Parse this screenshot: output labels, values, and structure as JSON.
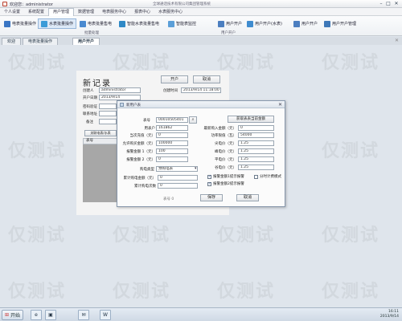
{
  "titlebar": {
    "title": "欢迎您：administrator",
    "center": "全球通话技术有限公司集团管理系统"
  },
  "menu": [
    "个人设置",
    "系统配置",
    "用户管理",
    "数据管理",
    "电表服务中心",
    "报表中心",
    "水表服务中心"
  ],
  "ribbon": {
    "buttons": [
      {
        "label": "电表批量操作",
        "color": "#3a76c4"
      },
      {
        "label": "水表批量操作",
        "color": "#3a9bd8"
      },
      {
        "label": "电表批量售电",
        "color": "#4a8ad0"
      },
      {
        "label": "智能水表批量售电",
        "color": "#2f89c6"
      },
      {
        "label": "智能表监控",
        "color": "#5b9fd8"
      },
      {
        "label": "用户开户",
        "color": "#4c7fc0"
      },
      {
        "label": "用户开户(水表)",
        "color": "#3f8ccf"
      },
      {
        "label": "用户开户",
        "color": "#4c7fc0"
      },
      {
        "label": "用户开户管理",
        "color": "#3e78b8"
      }
    ],
    "group_labels": [
      "批量处理",
      "用户开户"
    ]
  },
  "tabs": [
    "欢迎",
    "电表批量操作",
    "用户开户"
  ],
  "form": {
    "heading": "新记录",
    "open_button": "开户",
    "cancel_button": "取消",
    "create_time_label": "创建时间",
    "create_time": "2013/9/14 11:18:00",
    "creator_label": "创建人",
    "creator": "administrator",
    "account_label": "开户日期",
    "account_value": "2013/9/14",
    "fields": [
      "密码验证",
      "联系地址",
      "备注"
    ],
    "grid_header": "表号",
    "bind_button": "关联电表/水表"
  },
  "dialog": {
    "title": "新用户表",
    "meter_no_label": "表号",
    "meter_no": "00010505401",
    "read_button": "获取表表当前金额",
    "left_fields": [
      {
        "label": "用表户",
        "value": "161862"
      },
      {
        "label": "当次充值（元）",
        "value": "0"
      },
      {
        "label": "允许购买金额（元）",
        "value": "100000"
      },
      {
        "label": "报警金额 1（元）",
        "value": "100"
      },
      {
        "label": "报警金额 2（元）",
        "value": "0"
      }
    ],
    "price_type_label": "购电类型",
    "price_type_value": "预购电表",
    "right_fields": [
      {
        "label": "最新购入金额（元）",
        "value": "0"
      },
      {
        "label": "功率限值（瓦）",
        "value": "54000"
      },
      {
        "label": "尖电价（元）",
        "value": "1.25"
      },
      {
        "label": "峰电价（元）",
        "value": "1.25"
      },
      {
        "label": "平电价（元）",
        "value": "1.25"
      },
      {
        "label": "谷电价（元）",
        "value": "1.25"
      }
    ],
    "tou_mode_label": "分时计费模式",
    "check1": "报警金额1提示报警",
    "check2": "报警金额2提示报警",
    "bottom_fields": [
      {
        "label": "累计购电金额（元）",
        "value": "0"
      },
      {
        "label": "累计购电次数",
        "value": "0"
      }
    ],
    "status_text": "表号 0",
    "save_button": "保存",
    "cancel_button": "取消"
  },
  "watermark": "仅测试",
  "taskbar": {
    "start": "开始",
    "icons": [
      "e",
      "▣",
      "✉",
      "W"
    ],
    "time": "16:11",
    "date": "2013/9/14"
  }
}
